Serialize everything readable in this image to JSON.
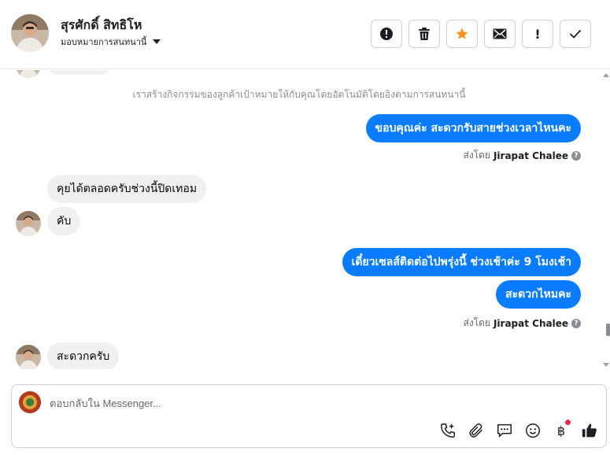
{
  "header": {
    "contact_name": "สุรศักดิ์ สิทธิโห",
    "assign_label": "มอบหมายการสนทนานี้",
    "toolbar": [
      {
        "name": "report-button",
        "icon": "alert-circle-icon"
      },
      {
        "name": "delete-button",
        "icon": "trash-icon"
      },
      {
        "name": "star-button",
        "icon": "star-icon",
        "color": "#f7931e"
      },
      {
        "name": "mark-unread-button",
        "icon": "envelope-icon"
      },
      {
        "name": "follow-up-button",
        "icon": "exclamation-icon",
        "text": "!"
      },
      {
        "name": "mark-done-button",
        "icon": "check-icon"
      }
    ]
  },
  "conversation": {
    "system_notice": "เราสร้างกิจกรรมของลูกค้าเป้าหมายให้กับคุณโดยอัตโนมัติโดยอิงตามการสนทนานี้",
    "messages": [
      {
        "direction": "out",
        "text": "ขอบคุณค่ะ สะดวกรับสายช่วงเวลาไหนคะ"
      },
      {
        "direction": "in",
        "text": "คุยได้ตลอดครับช่วงนี้ปิดเทอม"
      },
      {
        "direction": "in",
        "text": "คับ"
      },
      {
        "direction": "out",
        "text": "เดี๋ยวเซลส์ติดต่อไปพรุ่งนี้ ช่วงเช้าค่ะ 9 โมงเช้า"
      },
      {
        "direction": "out",
        "text": "สะดวกไหมคะ"
      },
      {
        "direction": "in",
        "text": "สะดวกครับ"
      }
    ],
    "sent_by_prefix": "ส่งโดย",
    "sent_by_name": "Jirapat Chalee",
    "info_glyph": "?"
  },
  "composer": {
    "placeholder": "ตอบกลับใน Messenger...",
    "currency_glyph": "฿"
  },
  "colors": {
    "outgoing_bubble": "#0a7cff",
    "incoming_bubble": "#eff0f2",
    "accent_star": "#f7931e",
    "notification_dot": "#f02849"
  }
}
